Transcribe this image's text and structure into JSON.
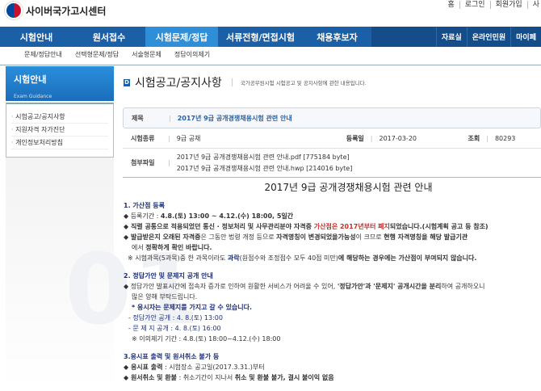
{
  "site": {
    "name": "사이버국가고시센터",
    "top_links": [
      "홈",
      "로그인",
      "회원가입",
      "사"
    ]
  },
  "nav": {
    "items": [
      "시험안내",
      "원서접수",
      "시험문제/정답",
      "서류전형/면접시험",
      "채용후보자"
    ],
    "right": [
      "자료실",
      "온라인민원",
      "마이페"
    ]
  },
  "subnav": [
    "문제/정답안내",
    "선택형문제/정답",
    "서술형문제",
    "정답이의제기"
  ],
  "left": {
    "title": "시험안내",
    "subtitle": "Exam Guidance",
    "menu": [
      "시험공고/공지사항",
      "지원자격 자가진단",
      "개인정보처리방침"
    ],
    "watermark": "01"
  },
  "page": {
    "badge": "D",
    "title": "시험공고/공지사항",
    "desc": "국가공무원시험 시험공고 및 공지사항에 관한 내용입니다."
  },
  "info": {
    "title_label": "제목",
    "title": "2017년 9급 공개경쟁채용시험 관련 안내",
    "type_label": "시험종류",
    "type": "9급 공채",
    "date_label": "등록일",
    "date": "2017-03-20",
    "views_label": "조회",
    "views": "80293",
    "files_label": "첨부파일",
    "files": [
      "2017년 9급 공개경쟁채용시험 관련 안내.pdf [775184 byte]",
      "2017년 9급 공개경쟁채용시험 관련 안내.hwp [214016 byte]"
    ]
  },
  "article": {
    "heading": "2017년 9급 공개경쟁채용시험 관련 안내",
    "s1": {
      "h": "1. 가산점 등록",
      "l1a": "◆ 등록기간 : ",
      "l1b": "4.8.(토) 13:00 ~ 4.12.(수) 18:00, 5일간",
      "l2a": "◆ 직렬 공통으로 적용되었던 통신 · 정보처리 및 사무관리분야 자격증 ",
      "l2b": "가산점은 2017년부터 폐지",
      "l2c": "되었습니다.(시험계획 공고 등 참조)",
      "l3a": "◆ 발급받은지 오래된 자격증",
      "l3b": "은 그동안 법령 개정 등으로 ",
      "l3c": "자격명칭이 변경되었을가능성",
      "l3d": "이 크므로 ",
      "l3e": "현행 자격명칭을 해당 발급기관",
      "l4a": "에서 ",
      "l4b": "정확하게 확인 바랍니다.",
      "l5a": "※ 시험과목(5과목)중 한 과목이라도 ",
      "l5b": "과락",
      "l5c": "(원점수와 조정점수 모두 40점 미만)",
      "l5d": "에 해당하는 경우에는 가산점이 부여되지 않습니다."
    },
    "s2": {
      "h": "2. 정답가안 및 문제지 공개 안내",
      "l1a": "◆ 정답가안 발표시간에 접속자 증가로 인하여 원활한 서비스가 어려울 수 있어, ",
      "l1b": "'정답가안'과 '문제지' 공개시간을 분리",
      "l1c": "하여 공개하오니",
      "l2": "많은 양해 부탁드립니다.",
      "l3": "* 응시자는 문제지를 가지고 갈 수 있습니다.",
      "l4": "- 정답가안 공개 : 4. 8.(토) 13:00",
      "l5": "- 문 제 지 공개 : 4. 8.(토) 16:00",
      "l6": "※ 이의제기 기간 : 4.8.(토) 18:00~4.12.(수) 18:00"
    },
    "s3": {
      "h": "3.응시표 출력 및 원서취소 불가 등",
      "l1a": "◆ 응시표 출력",
      "l1b": " : 시험장소 공고일(2017.3.31.)부터",
      "l2a": "◆ 원서취소 및 환불",
      "l2b": " : 취소기간이 지나서 ",
      "l2c": "취소 및 환불 불가, 결시 불이익 없음"
    }
  }
}
